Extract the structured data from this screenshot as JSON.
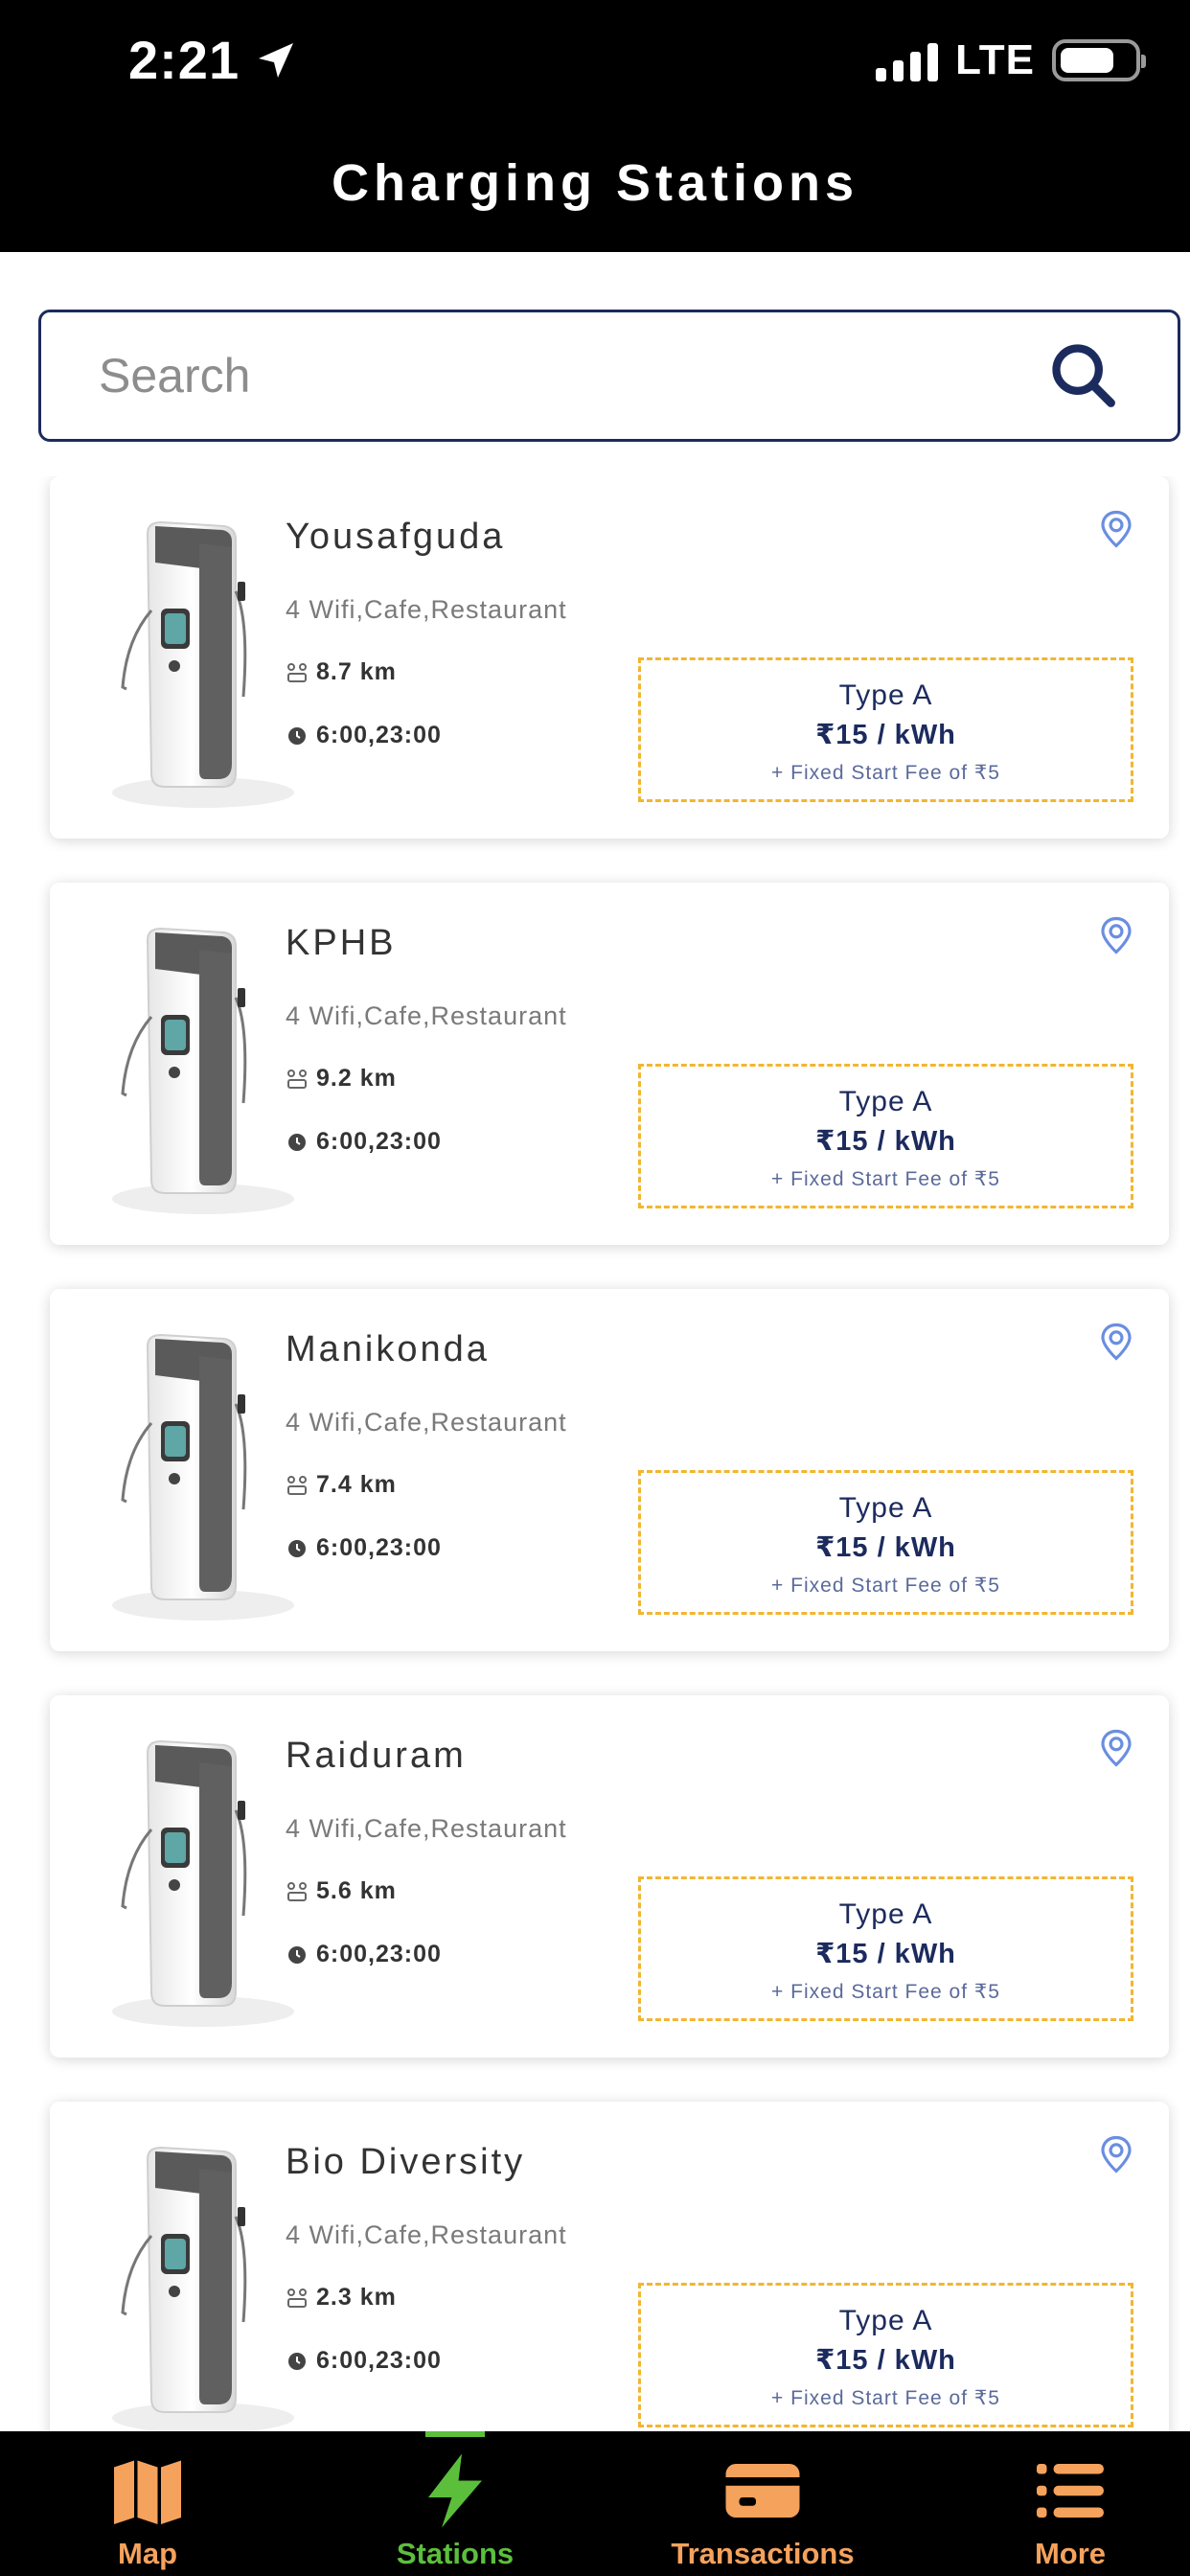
{
  "status_bar": {
    "time": "2:21",
    "network": "LTE"
  },
  "header": {
    "title": "Charging Stations"
  },
  "search": {
    "placeholder": "Search"
  },
  "stations": [
    {
      "name": "Yousafguda",
      "amenities": "4 Wifi,Cafe,Restaurant",
      "distance": "8.7 km",
      "hours": "6:00,23:00",
      "type": "Type A",
      "rate": "₹15 / kWh",
      "fee": "+ Fixed Start Fee of ₹5"
    },
    {
      "name": "KPHB",
      "amenities": "4 Wifi,Cafe,Restaurant",
      "distance": "9.2 km",
      "hours": "6:00,23:00",
      "type": "Type A",
      "rate": "₹15 / kWh",
      "fee": "+ Fixed Start Fee of ₹5"
    },
    {
      "name": "Manikonda",
      "amenities": "4 Wifi,Cafe,Restaurant",
      "distance": "7.4 km",
      "hours": "6:00,23:00",
      "type": "Type A",
      "rate": "₹15 / kWh",
      "fee": "+ Fixed Start Fee of ₹5"
    },
    {
      "name": "Raiduram",
      "amenities": "4 Wifi,Cafe,Restaurant",
      "distance": "5.6 km",
      "hours": "6:00,23:00",
      "type": "Type A",
      "rate": "₹15 / kWh",
      "fee": "+ Fixed Start Fee of ₹5"
    },
    {
      "name": "Bio Diversity",
      "amenities": "4 Wifi,Cafe,Restaurant",
      "distance": "2.3 km",
      "hours": "6:00,23:00",
      "type": "Type A",
      "rate": "₹15 / kWh",
      "fee": "+ Fixed Start Fee of ₹5"
    }
  ],
  "nav": {
    "items": [
      {
        "label": "Map",
        "icon": "map-icon",
        "active": false
      },
      {
        "label": "Stations",
        "icon": "bolt-icon",
        "active": true
      },
      {
        "label": "Transactions",
        "icon": "card-icon",
        "active": false
      },
      {
        "label": "More",
        "icon": "list-icon",
        "active": false
      }
    ]
  },
  "colors": {
    "accent_orange": "#f5a25d",
    "active_green": "#5cbf3c",
    "navy": "#1c2b5e",
    "price_border": "#f2b630",
    "pin_blue": "#6a8ee0"
  }
}
